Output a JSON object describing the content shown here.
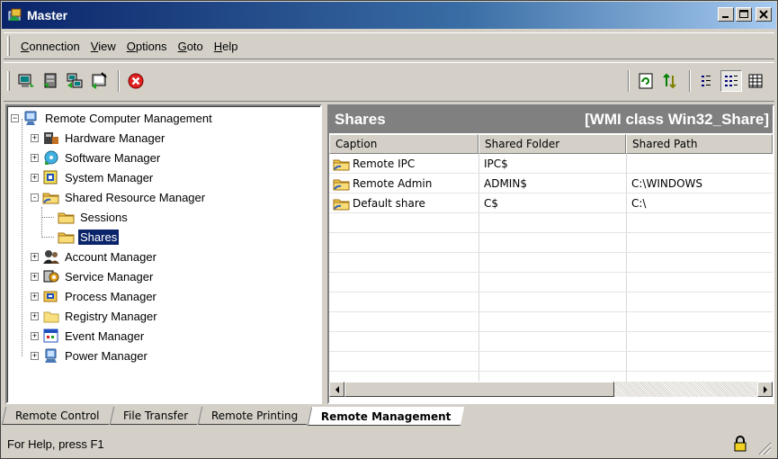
{
  "window": {
    "title": "Master"
  },
  "menu": [
    {
      "label": "Connection",
      "accel": "C",
      "rest": "onnection"
    },
    {
      "label": "View",
      "accel": "V",
      "rest": "iew"
    },
    {
      "label": "Options",
      "accel": "O",
      "rest": "ptions"
    },
    {
      "label": "Goto",
      "accel": "G",
      "rest": "oto"
    },
    {
      "label": "Help",
      "accel": "H",
      "rest": "elp"
    }
  ],
  "toolbar": {
    "left_icons": [
      "connect-icon",
      "disconnect-icon",
      "network-icon",
      "properties-icon",
      "stop-icon"
    ],
    "right_icons": [
      "refresh-icon",
      "sort-icon",
      "list-view-icon",
      "details-view-icon",
      "large-icons-view-icon"
    ]
  },
  "tree": {
    "root": "Remote Computer Management",
    "items": [
      {
        "label": "Hardware Manager",
        "icon": "hardware-icon",
        "expander": "+"
      },
      {
        "label": "Software Manager",
        "icon": "software-icon",
        "expander": "+"
      },
      {
        "label": "System Manager",
        "icon": "system-icon",
        "expander": "+"
      },
      {
        "label": "Shared Resource Manager",
        "icon": "folder-icon",
        "expander": "-"
      },
      {
        "label": "Sessions",
        "icon": "folder-icon",
        "child": true
      },
      {
        "label": "Shares",
        "icon": "folder-icon",
        "child": true,
        "selected": true
      },
      {
        "label": "Account Manager",
        "icon": "account-icon",
        "expander": "+"
      },
      {
        "label": "Service Manager",
        "icon": "service-icon",
        "expander": "+"
      },
      {
        "label": "Process Manager",
        "icon": "process-icon",
        "expander": "+"
      },
      {
        "label": "Registry Manager",
        "icon": "registry-folder-icon",
        "expander": "+"
      },
      {
        "label": "Event Manager",
        "icon": "event-icon",
        "expander": "+"
      },
      {
        "label": "Power Manager",
        "icon": "power-icon",
        "expander": "+"
      }
    ]
  },
  "pane": {
    "title": "Shares",
    "wmi_class": "[WMI class Win32_Share]",
    "columns": [
      "Caption",
      "Shared Folder",
      "Shared Path"
    ],
    "rows": [
      {
        "caption": "Remote IPC",
        "folder": "IPC$",
        "path": ""
      },
      {
        "caption": "Remote Admin",
        "folder": "ADMIN$",
        "path": "C:\\WINDOWS"
      },
      {
        "caption": "Default share",
        "folder": "C$",
        "path": "C:\\"
      }
    ]
  },
  "tabs": [
    "Remote Control",
    "File Transfer",
    "Remote Printing",
    "Remote Management"
  ],
  "active_tab": "Remote Management",
  "status": {
    "text": "For Help, press F1"
  },
  "colors": {
    "title_start": "#0a246a",
    "title_end": "#a6caf0",
    "pane_header": "#808080",
    "selection": "#0a246a",
    "stop_red": "#e02020"
  }
}
